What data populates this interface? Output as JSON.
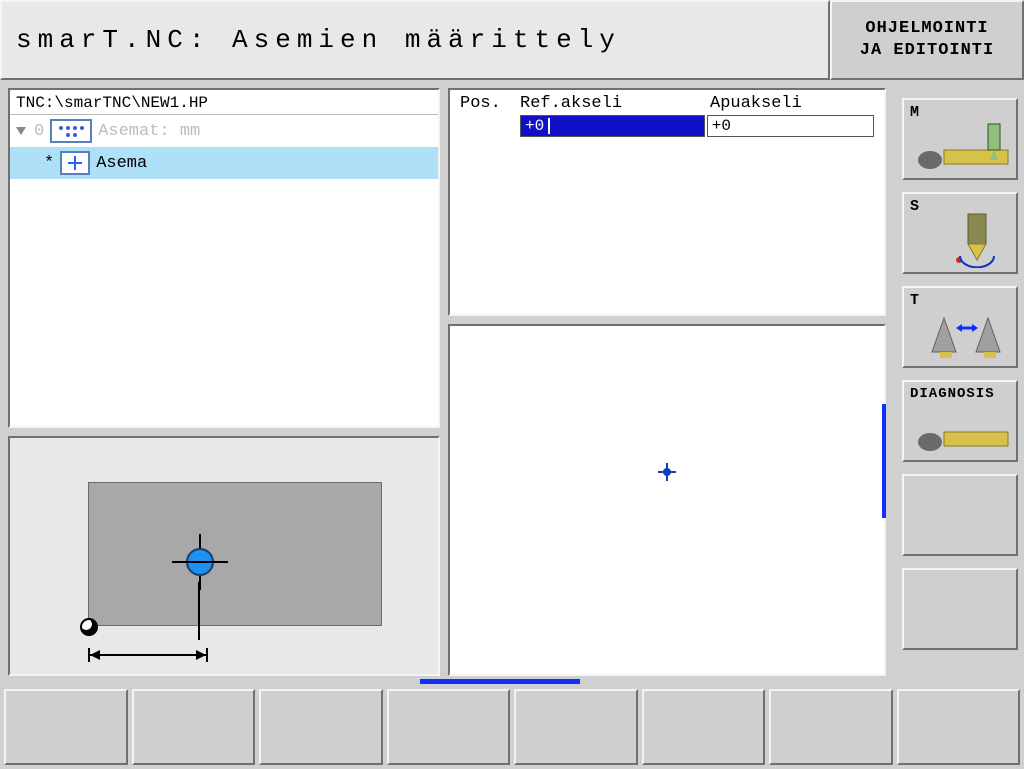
{
  "title": {
    "main": "smarT.NC: Asemien määrittely",
    "side_line1": "OHJELMOINTI",
    "side_line2": "JA EDITOINTI"
  },
  "tree": {
    "path": "TNC:\\smarTNC\\NEW1.HP",
    "root_index": "0",
    "root_label": "Asemat: mm",
    "item_marker": "*",
    "item_label": "Asema"
  },
  "params": {
    "header_pos": "Pos.",
    "header_ref": "Ref.akseli",
    "header_apu": "Apuakseli",
    "ref_value": "+0",
    "apu_value": "+0"
  },
  "right_buttons": {
    "m": "M",
    "s": "S",
    "t": "T",
    "diag": "DIAGNOSIS"
  }
}
